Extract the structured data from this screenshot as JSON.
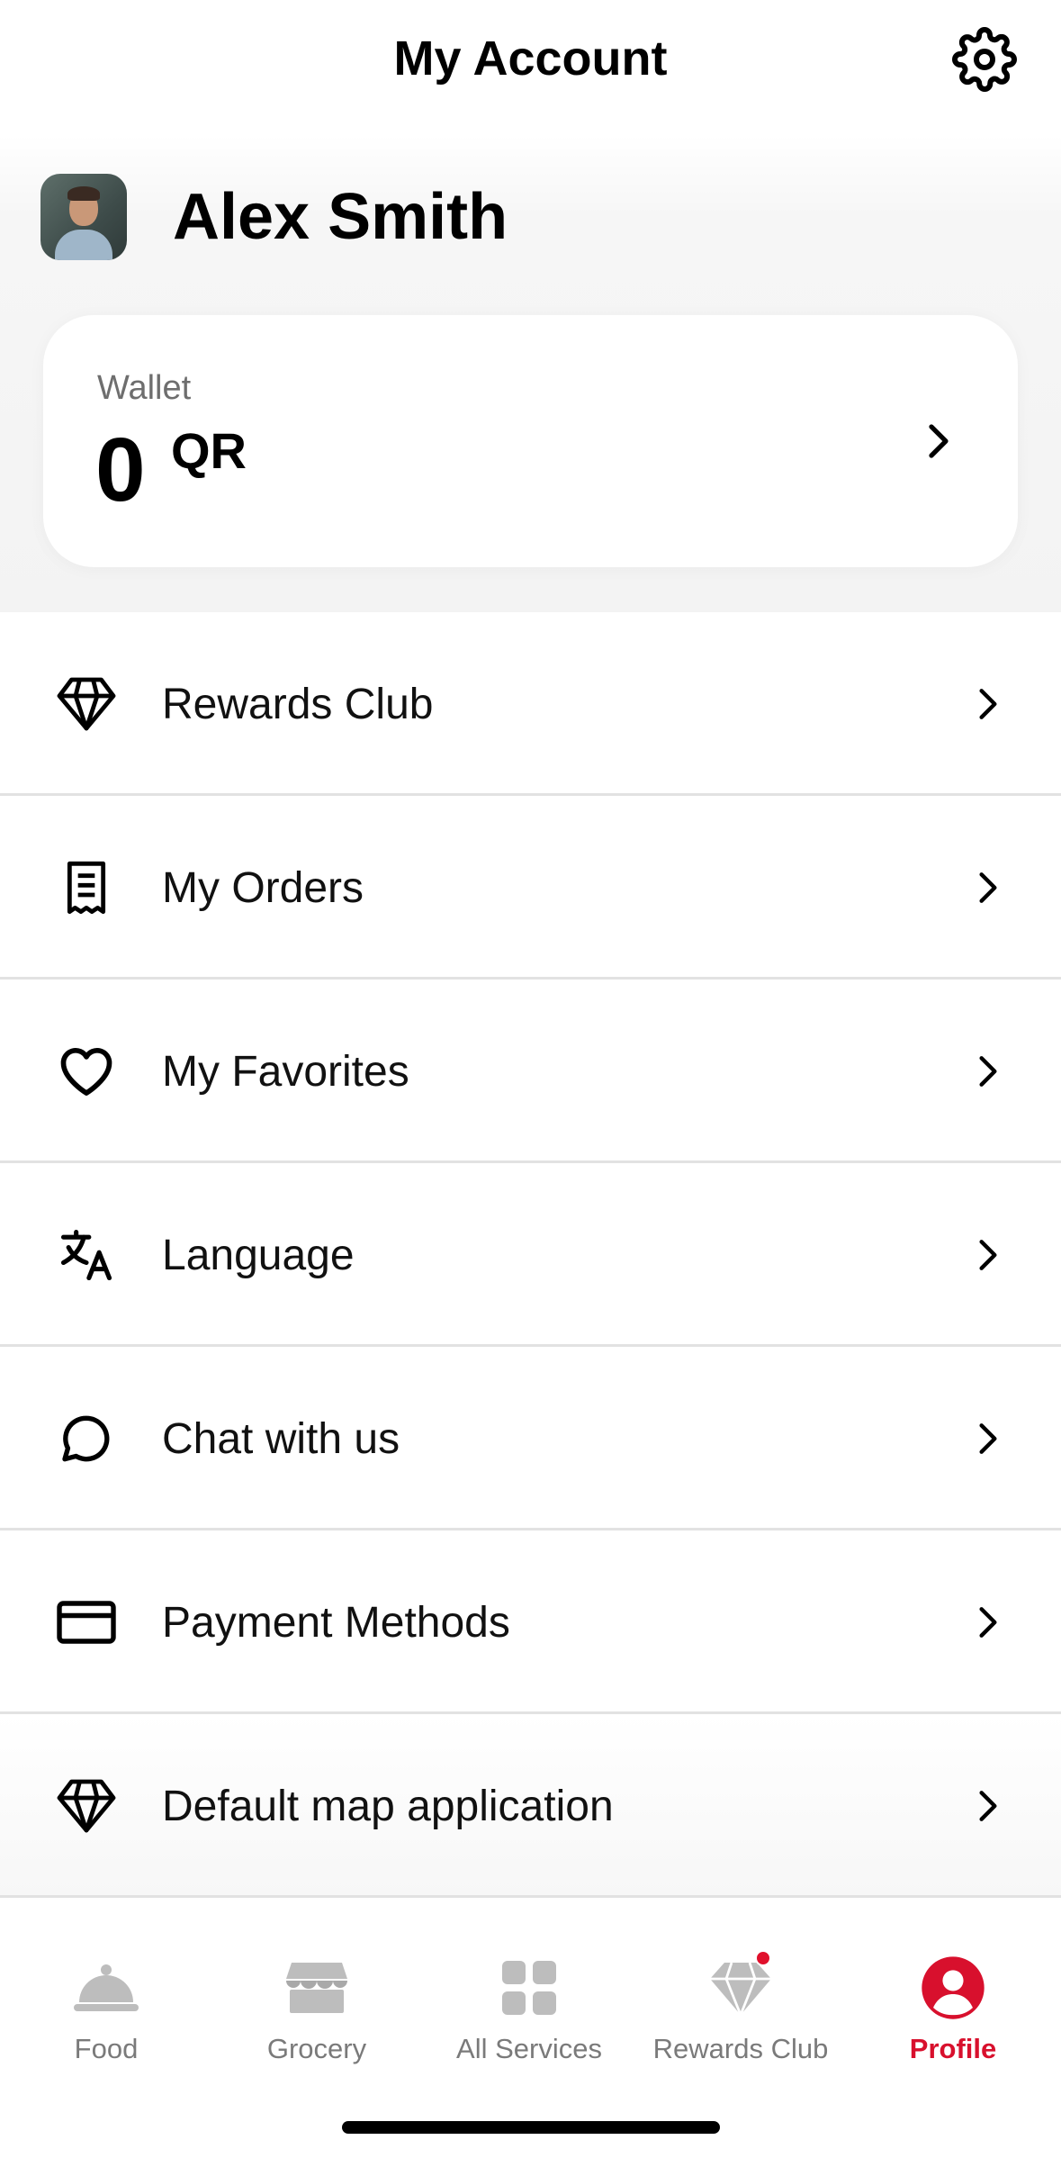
{
  "header": {
    "title": "My Account",
    "settings_icon": "gear-icon"
  },
  "profile": {
    "name": "Alex Smith"
  },
  "wallet": {
    "label": "Wallet",
    "amount": "0",
    "currency": "QR"
  },
  "menu": [
    {
      "label": "Rewards Club",
      "icon": "diamond-icon"
    },
    {
      "label": "My Orders",
      "icon": "receipt-icon"
    },
    {
      "label": "My Favorites",
      "icon": "heart-icon"
    },
    {
      "label": "Language",
      "icon": "translate-icon"
    },
    {
      "label": "Chat with us",
      "icon": "chat-bubble-icon"
    },
    {
      "label": "Payment Methods",
      "icon": "credit-card-icon"
    },
    {
      "label": "Default map application",
      "icon": "diamond-icon"
    }
  ],
  "tabs": [
    {
      "label": "Food",
      "icon": "cloche-icon",
      "active": false
    },
    {
      "label": "Grocery",
      "icon": "store-icon",
      "active": false
    },
    {
      "label": "All Services",
      "icon": "grid-icon",
      "active": false
    },
    {
      "label": "Rewards Club",
      "icon": "diamond-icon",
      "active": false,
      "badge": true
    },
    {
      "label": "Profile",
      "icon": "user-circle-icon",
      "active": true
    }
  ],
  "colors": {
    "accent": "#d8102d",
    "inactive_tab": "#7a7a7a",
    "divider": "#e2e2e2"
  }
}
